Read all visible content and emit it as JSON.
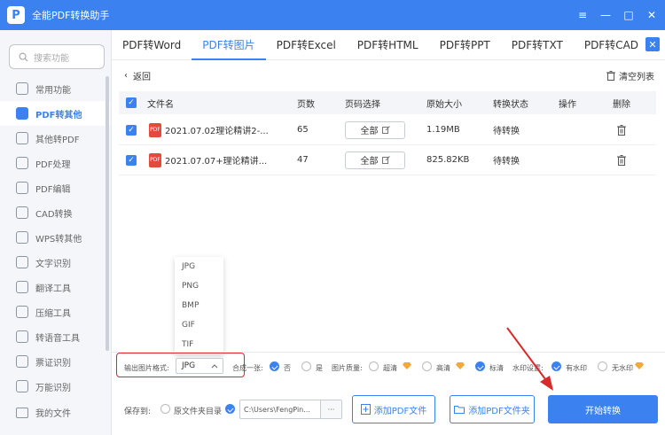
{
  "app": {
    "logo_letter": "P",
    "title": "全能PDF转换助手"
  },
  "window": {
    "menu_icon": "≡",
    "minimize_icon": "—",
    "maximize_icon": "□",
    "close_icon": "✕"
  },
  "sidebar": {
    "search_placeholder": "搜索功能",
    "items": [
      {
        "label": "常用功能"
      },
      {
        "label": "PDF转其他"
      },
      {
        "label": "其他转PDF"
      },
      {
        "label": "PDF处理"
      },
      {
        "label": "PDF编辑"
      },
      {
        "label": "CAD转换"
      },
      {
        "label": "WPS转其他"
      },
      {
        "label": "文字识别"
      },
      {
        "label": "翻译工具"
      },
      {
        "label": "压缩工具"
      },
      {
        "label": "转语音工具"
      },
      {
        "label": "票证识别"
      },
      {
        "label": "万能识别"
      }
    ],
    "my_files": "我的文件"
  },
  "tabs": [
    "PDF转Word",
    "PDF转图片",
    "PDF转Excel",
    "PDF转HTML",
    "PDF转PPT",
    "PDF转TXT",
    "PDF转CAD"
  ],
  "panel_close_icon": "✕",
  "toolbar": {
    "back": "返回",
    "clear": "清空列表"
  },
  "table": {
    "headers": {
      "name": "文件名",
      "pages": "页数",
      "page_select": "页码选择",
      "size": "原始大小",
      "status": "转换状态",
      "action": "操作",
      "delete": "删除"
    },
    "pdf_badge": "PDF",
    "rows": [
      {
        "name": "2021.07.02理论精讲2-...",
        "pages": "65",
        "page_select": "全部",
        "size": "1.19MB",
        "status": "待转换"
      },
      {
        "name": "2021.07.07+理论精讲...",
        "pages": "47",
        "page_select": "全部",
        "size": "825.82KB",
        "status": "待转换"
      }
    ]
  },
  "format_dropdown": {
    "options": [
      "JPG",
      "PNG",
      "BMP",
      "GIF",
      "TIF"
    ]
  },
  "options": {
    "format_label": "输出图片格式:",
    "format_value": "JPG",
    "merge_label": "合成一张:",
    "merge_no": "否",
    "merge_yes": "是",
    "quality_label": "图片质量:",
    "quality_super": "超清",
    "quality_high": "高清",
    "quality_std": "标清",
    "watermark_label": "水印设置:",
    "watermark_on": "有水印",
    "watermark_off": "无水印"
  },
  "output": {
    "save_to": "保存到:",
    "orig_dir": "原文件夹目录",
    "path": "C:\\Users\\FengPin...",
    "more": "···"
  },
  "buttons": {
    "add_file": "添加PDF文件",
    "add_folder": "添加PDF文件夹",
    "start": "开始转换"
  },
  "colors": {
    "accent": "#3b82f0",
    "highlight": "#d72a2a",
    "premium": "#f2a93b"
  }
}
